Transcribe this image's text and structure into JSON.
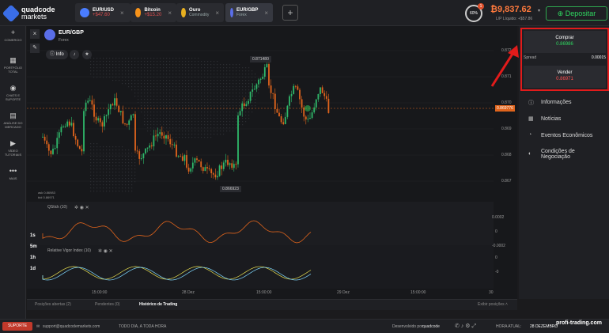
{
  "brand": {
    "name_line1": "quadcode",
    "name_line2": "markets"
  },
  "tabs": [
    {
      "name": "EUR/USD",
      "sub": "+$47.60",
      "color": "#4a7dff"
    },
    {
      "name": "Bitcoin",
      "sub": "+$15.20",
      "color": "#f7931a"
    },
    {
      "name": "Ouro",
      "sub": "Commodity",
      "color": "#e8b020"
    },
    {
      "name": "EUR/GBP",
      "sub": "Forex",
      "color": "#5a6ee8"
    }
  ],
  "header": {
    "progress": "60%",
    "progress_value": 0.6,
    "notification_count": "1",
    "balance": "₿9,837.62",
    "balance_sub": "L/P Líquido: +$57.86",
    "deposit_label": "Depositar"
  },
  "sidebar": [
    {
      "label": "COMERCIO",
      "icon": "+"
    },
    {
      "label": "PORTFÓLIO TOTAL",
      "icon": "▦"
    },
    {
      "label": "CHATS E SUPORTE",
      "icon": "◉"
    },
    {
      "label": "ANÁLISE DO MERCADO",
      "icon": "▤"
    },
    {
      "label": "VÍDEO TUTORIAIS",
      "icon": "▶"
    },
    {
      "label": "MAIS",
      "icon": "•••"
    }
  ],
  "asset": {
    "name": "EUR/GBP",
    "type": "Forex",
    "info_label": "Info",
    "ask": "ask 0.86983",
    "bid": "bid 0.86971"
  },
  "price_axis": [
    "0.872",
    "0.871",
    "0.870",
    "0.869",
    "0.868",
    "0.867"
  ],
  "current_price": "0.869776",
  "high_label": "0.871480",
  "low_label": "0.866923",
  "indicators": [
    {
      "name": "QStick (10)",
      "axis": [
        "0.0002",
        "0",
        "-0.0002"
      ]
    },
    {
      "name": "Relative Vigor Index (10)",
      "axis": [
        "0",
        "-0"
      ]
    }
  ],
  "time_labels": [
    "15:00:00",
    "28 Dez",
    "15:00:00",
    "29 Dez",
    "15:00:00",
    "30"
  ],
  "timeframes": [
    "1s",
    "5m",
    "1h",
    "1d"
  ],
  "trade": {
    "buy_label": "Comprar",
    "buy_price": "0.86986",
    "spread_label": "Spread",
    "spread_value": "0.00015",
    "sell_label": "Vender",
    "sell_price": "0.86971"
  },
  "right_menu": [
    {
      "label": "Informações",
      "icon": "ⓘ"
    },
    {
      "label": "Notícias",
      "icon": "▦"
    },
    {
      "label": "Eventos Econômicos",
      "icon": "◔"
    },
    {
      "label": "Condições de Negociação",
      "icon": "◐"
    }
  ],
  "bottom_tabs": [
    "Posições abertas (2)",
    "Pendentes (0)",
    "Histórico de Trading"
  ],
  "bottom_right": "Exibir posições",
  "footer": {
    "support": "SUPORTE",
    "email": "support@quadcodemarkets.com",
    "hours": "TODO DIA, A TODA HORA",
    "powered": "Desenvolvido por",
    "powered_brand": "quadcode",
    "time_label": "HORA ATUAL:",
    "time_value": "28 DEZEMBRO"
  },
  "watermark": "profi-trading.com",
  "colors": {
    "up": "#2fb86a",
    "down": "#e0641c",
    "accent": "#e21b1b"
  }
}
